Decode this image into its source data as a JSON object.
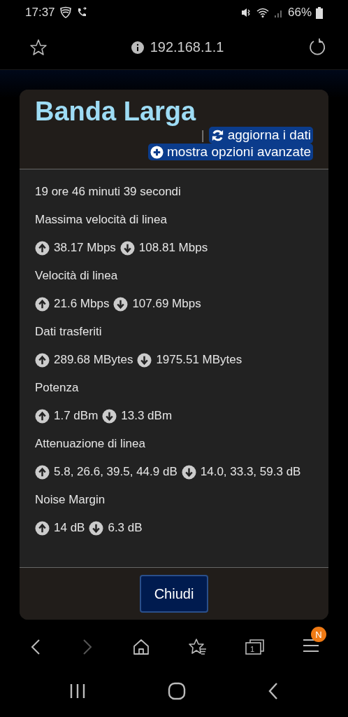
{
  "status_bar": {
    "time": "17:37",
    "battery": "66%"
  },
  "address_bar": {
    "url": "192.168.1.1"
  },
  "dialog": {
    "title": "Banda Larga",
    "separator": "|",
    "actions": [
      {
        "kind": "refresh",
        "label": "aggiorna i dati"
      },
      {
        "kind": "plus",
        "label": "mostra opzioni avanzate"
      }
    ],
    "uptime": "19 ore 46 minuti 39 secondi",
    "stats": [
      {
        "label": "Massima velocità di linea",
        "up": "38.17 Mbps",
        "down": "108.81 Mbps"
      },
      {
        "label": "Velocità di linea",
        "up": "21.6 Mbps",
        "down": "107.69 Mbps"
      },
      {
        "label": "Dati trasferiti",
        "up": "289.68 MBytes",
        "down": "1975.51 MBytes"
      },
      {
        "label": "Potenza",
        "up": "1.7 dBm",
        "down": "13.3 dBm"
      },
      {
        "label": "Attenuazione di linea",
        "up": "5.8, 26.6, 39.5, 44.9 dB",
        "down": "14.0, 33.3, 59.3 dB"
      },
      {
        "label": "Noise Margin",
        "up": "14 dB",
        "down": "6.3 dB"
      }
    ],
    "close_button": "Chiudi"
  },
  "browser_toolbar": {
    "tabs_count": "1",
    "menu_badge": "N"
  }
}
